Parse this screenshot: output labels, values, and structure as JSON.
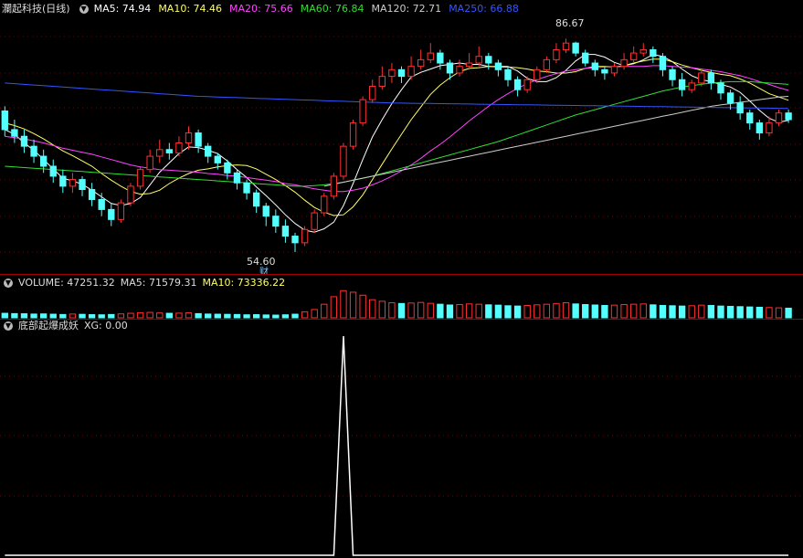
{
  "main": {
    "title": "瀾起科技(日线)",
    "ma": [
      {
        "label": "MA5: 74.94",
        "color": "#ffffff"
      },
      {
        "label": "MA10: 74.46",
        "color": "#ffff66"
      },
      {
        "label": "MA20: 75.66",
        "color": "#ff44ff"
      },
      {
        "label": "MA60: 76.84",
        "color": "#33dd33"
      },
      {
        "label": "MA120: 72.71",
        "color": "#cccccc"
      },
      {
        "label": "MA250: 66.88",
        "color": "#3355ff"
      }
    ],
    "high_label": "86.67",
    "low_label": "54.60",
    "fin_marker": "财"
  },
  "volume": {
    "labels": [
      {
        "label": "VOLUME: 47251.32",
        "color": "#dddddd"
      },
      {
        "label": "MA5: 71579.31",
        "color": "#dddddd"
      },
      {
        "label": "MA10: 73336.22",
        "color": "#ffff66"
      }
    ]
  },
  "indicator": {
    "name": "底部起爆成妖",
    "xg": "XG: 0.00"
  },
  "colors": {
    "up": "#ff3030",
    "down": "#54ffff",
    "bg": "#000000",
    "grid": "#7a0000"
  },
  "chart_data": {
    "type": "candlestick",
    "price_range": [
      52,
      90
    ],
    "candles": [
      [
        75.8,
        73.0,
        76.5,
        72.0
      ],
      [
        73.0,
        72.0,
        74.5,
        71.0
      ],
      [
        72.0,
        70.5,
        73.0,
        69.5
      ],
      [
        70.5,
        69.0,
        71.5,
        68.0
      ],
      [
        69.0,
        67.5,
        70.0,
        66.5
      ],
      [
        67.5,
        66.0,
        68.5,
        65.0
      ],
      [
        66.0,
        64.5,
        67.0,
        63.5
      ],
      [
        64.5,
        65.5,
        66.5,
        63.5
      ],
      [
        65.5,
        64.0,
        66.0,
        63.0
      ],
      [
        64.0,
        62.5,
        65.0,
        61.5
      ],
      [
        62.5,
        61.0,
        63.5,
        60.0
      ],
      [
        61.0,
        59.5,
        62.0,
        58.5
      ],
      [
        59.5,
        62.0,
        62.5,
        59.0
      ],
      [
        62.0,
        64.5,
        65.0,
        61.5
      ],
      [
        64.5,
        67.0,
        67.5,
        64.0
      ],
      [
        67.0,
        69.0,
        70.0,
        66.5
      ],
      [
        69.0,
        70.0,
        71.5,
        68.0
      ],
      [
        70.0,
        69.5,
        71.0,
        68.5
      ],
      [
        69.5,
        71.0,
        72.0,
        69.0
      ],
      [
        71.0,
        72.5,
        73.5,
        70.0
      ],
      [
        72.5,
        70.5,
        73.0,
        69.5
      ],
      [
        70.5,
        69.0,
        71.0,
        68.0
      ],
      [
        69.0,
        68.0,
        69.5,
        67.0
      ],
      [
        68.0,
        66.5,
        68.5,
        65.5
      ],
      [
        66.5,
        65.0,
        67.0,
        64.0
      ],
      [
        65.0,
        63.5,
        65.5,
        62.5
      ],
      [
        63.5,
        61.5,
        64.0,
        60.5
      ],
      [
        61.5,
        60.0,
        62.0,
        58.5
      ],
      [
        60.0,
        58.5,
        61.0,
        57.5
      ],
      [
        58.5,
        57.0,
        59.5,
        56.0
      ],
      [
        57.0,
        56.0,
        57.5,
        54.6
      ],
      [
        56.0,
        58.0,
        58.5,
        55.5
      ],
      [
        58.0,
        60.5,
        61.0,
        57.5
      ],
      [
        60.5,
        63.0,
        63.5,
        60.0
      ],
      [
        63.0,
        66.0,
        66.5,
        62.5
      ],
      [
        66.0,
        70.5,
        71.0,
        65.5
      ],
      [
        70.5,
        74.0,
        74.5,
        70.0
      ],
      [
        74.0,
        77.5,
        78.0,
        73.5
      ],
      [
        77.5,
        79.5,
        80.5,
        77.0
      ],
      [
        79.5,
        81.0,
        82.5,
        79.0
      ],
      [
        81.0,
        82.0,
        83.0,
        80.0
      ],
      [
        82.0,
        81.0,
        82.5,
        80.0
      ],
      [
        81.0,
        82.5,
        84.0,
        80.5
      ],
      [
        82.5,
        83.5,
        85.0,
        82.0
      ],
      [
        83.5,
        84.5,
        86.0,
        83.0
      ],
      [
        84.5,
        83.0,
        85.0,
        82.0
      ],
      [
        83.0,
        81.5,
        83.5,
        80.5
      ],
      [
        81.5,
        82.5,
        83.5,
        81.0
      ],
      [
        82.5,
        83.0,
        84.5,
        82.0
      ],
      [
        83.0,
        84.0,
        85.5,
        82.5
      ],
      [
        84.0,
        83.0,
        84.5,
        82.0
      ],
      [
        83.0,
        82.0,
        83.5,
        81.0
      ],
      [
        82.0,
        80.5,
        82.5,
        79.5
      ],
      [
        80.5,
        79.0,
        81.0,
        78.0
      ],
      [
        79.0,
        80.5,
        81.0,
        78.5
      ],
      [
        80.5,
        82.0,
        82.5,
        80.0
      ],
      [
        82.0,
        83.5,
        84.0,
        81.5
      ],
      [
        83.5,
        85.0,
        86.0,
        83.0
      ],
      [
        85.0,
        86.0,
        86.67,
        84.5
      ],
      [
        86.0,
        84.5,
        86.2,
        84.0
      ],
      [
        84.5,
        83.0,
        85.0,
        82.5
      ],
      [
        83.0,
        82.0,
        83.5,
        81.0
      ],
      [
        82.0,
        81.5,
        82.5,
        80.5
      ],
      [
        81.5,
        82.5,
        83.0,
        81.0
      ],
      [
        82.5,
        83.5,
        84.5,
        82.0
      ],
      [
        83.5,
        84.5,
        85.5,
        83.0
      ],
      [
        84.5,
        85.0,
        86.0,
        84.0
      ],
      [
        85.0,
        84.0,
        85.5,
        83.0
      ],
      [
        84.0,
        82.0,
        84.5,
        81.0
      ],
      [
        82.0,
        80.5,
        82.5,
        79.5
      ],
      [
        80.5,
        79.0,
        81.5,
        78.0
      ],
      [
        79.0,
        80.0,
        80.5,
        78.5
      ],
      [
        80.0,
        81.5,
        82.0,
        79.5
      ],
      [
        81.5,
        80.0,
        82.0,
        79.0
      ],
      [
        80.0,
        78.5,
        80.5,
        77.5
      ],
      [
        78.5,
        77.0,
        79.0,
        76.0
      ],
      [
        77.0,
        75.5,
        78.0,
        74.5
      ],
      [
        75.5,
        74.0,
        76.0,
        73.0
      ],
      [
        74.0,
        72.5,
        74.5,
        71.5
      ],
      [
        72.5,
        74.0,
        75.0,
        72.0
      ],
      [
        74.0,
        75.5,
        76.0,
        73.5
      ],
      [
        75.5,
        74.5,
        76.0,
        74.0
      ]
    ],
    "ma5": [
      73,
      72.3,
      71,
      69.9,
      68.5,
      67.1,
      65.7,
      65.3,
      64.8,
      63.9,
      62.9,
      61.9,
      61.6,
      61.9,
      62.8,
      64.7,
      66.6,
      68.0,
      69.4,
      70.4,
      70.3,
      69.9,
      69.4,
      68.3,
      67.0,
      65.8,
      64.4,
      63.1,
      61.7,
      60.2,
      58.9,
      57.9,
      57.6,
      58.1,
      59.1,
      61.6,
      64.9,
      68.5,
      71.9,
      74.5,
      76.9,
      79.0,
      80.9,
      81.6,
      82.1,
      82.6,
      82.8,
      83.0,
      82.8,
      82.8,
      82.5,
      82.5,
      82.5,
      81.8,
      80.7,
      80.2,
      80.2,
      80.8,
      81.9,
      83.3,
      84.3,
      84.3,
      83.9,
      83.1,
      82.6,
      82.9,
      83.5,
      84.3,
      84.0,
      83.2,
      82.1,
      81.1,
      80.5,
      80.2,
      79.8,
      79.4,
      78.6,
      77.3,
      75.9,
      74.7,
      74.1,
      74.4
    ],
    "ma10": [
      74,
      73.6,
      73.1,
      72.4,
      71.6,
      70.7,
      69.8,
      69.1,
      68.3,
      67.5,
      66.4,
      65.4,
      64.5,
      63.7,
      63.3,
      63.4,
      63.9,
      64.9,
      65.7,
      66.4,
      66.9,
      67.1,
      67.4,
      67.6,
      67.7,
      67.6,
      67.1,
      66.3,
      65.5,
      64.6,
      63.6,
      62.4,
      61.3,
      60.6,
      60.1,
      60.2,
      61.4,
      63.2,
      65.5,
      67.8,
      70.1,
      72.3,
      74.5,
      76.4,
      78.3,
      79.7,
      80.8,
      81.7,
      82.2,
      82.3,
      82.5,
      82.4,
      82.4,
      82.3,
      82.1,
      81.8,
      81.7,
      81.5,
      81.5,
      81.7,
      82.2,
      82.5,
      82.5,
      82.4,
      82.6,
      83.0,
      83.3,
      83.6,
      83.6,
      83.2,
      82.7,
      82.3,
      81.9,
      81.6,
      81.3,
      81.1,
      80.6,
      80.0,
      79.2,
      78.4,
      77.9,
      77.4
    ],
    "ma20": [
      72,
      71.8,
      71.6,
      71.3,
      71.0,
      70.6,
      70.2,
      69.9,
      69.6,
      69.3,
      68.9,
      68.5,
      68.1,
      67.7,
      67.4,
      67.2,
      67.0,
      66.9,
      66.8,
      66.7,
      66.6,
      66.4,
      66.3,
      66.1,
      66.0,
      65.8,
      65.6,
      65.4,
      65.2,
      64.9,
      64.7,
      64.4,
      64.1,
      63.9,
      63.7,
      63.7,
      63.9,
      64.2,
      64.7,
      65.3,
      66.0,
      66.8,
      67.7,
      68.7,
      69.8,
      70.8,
      71.9,
      73.1,
      74.3,
      75.4,
      76.5,
      77.5,
      78.4,
      79.2,
      79.9,
      80.5,
      81.0,
      81.4,
      81.8,
      82.0,
      82.2,
      82.3,
      82.4,
      82.4,
      82.5,
      82.5,
      82.5,
      82.6,
      82.6,
      82.5,
      82.4,
      82.3,
      82.1,
      81.9,
      81.7,
      81.4,
      81.1,
      80.7,
      80.2,
      79.8,
      79.3,
      78.9
    ],
    "ma60": [
      67.5,
      67.4,
      67.3,
      67.2,
      67.1,
      67.0,
      66.9,
      66.8,
      66.7,
      66.6,
      66.5,
      66.4,
      66.3,
      66.2,
      66.1,
      66.0,
      65.9,
      65.8,
      65.7,
      65.6,
      65.5,
      65.4,
      65.3,
      65.2,
      65.1,
      65.0,
      64.9,
      64.8,
      64.7,
      64.6,
      64.5,
      64.5,
      64.6,
      64.7,
      64.9,
      65.1,
      65.4,
      65.7,
      66.0,
      66.4,
      66.8,
      67.2,
      67.6,
      68.0,
      68.4,
      68.8,
      69.2,
      69.6,
      70.0,
      70.4,
      70.8,
      71.2,
      71.7,
      72.2,
      72.7,
      73.2,
      73.7,
      74.2,
      74.7,
      75.2,
      75.6,
      76.0,
      76.4,
      76.8,
      77.2,
      77.6,
      78.0,
      78.4,
      78.8,
      79.1,
      79.4,
      79.6,
      79.8,
      80.0,
      80.1,
      80.2,
      80.2,
      80.2,
      80.1,
      80.0,
      79.9,
      79.8
    ],
    "ma120": [
      null,
      null,
      null,
      null,
      null,
      null,
      null,
      null,
      null,
      null,
      null,
      null,
      null,
      null,
      null,
      null,
      null,
      null,
      null,
      null,
      null,
      null,
      null,
      null,
      null,
      null,
      null,
      null,
      null,
      null,
      null,
      null,
      null,
      64.5,
      64.8,
      65.1,
      65.4,
      65.7,
      66.0,
      66.3,
      66.6,
      66.9,
      67.2,
      67.5,
      67.8,
      68.1,
      68.4,
      68.7,
      69.0,
      69.3,
      69.6,
      69.9,
      70.2,
      70.5,
      70.8,
      71.1,
      71.4,
      71.7,
      72.0,
      72.3,
      72.6,
      72.9,
      73.2,
      73.5,
      73.8,
      74.1,
      74.4,
      74.7,
      75.0,
      75.3,
      75.6,
      75.9,
      76.2,
      76.5,
      76.7,
      76.9,
      77.1,
      77.3,
      77.5,
      77.7,
      77.9,
      78.0
    ],
    "ma250": [
      80.0,
      79.9,
      79.8,
      79.7,
      79.6,
      79.5,
      79.4,
      79.3,
      79.2,
      79.1,
      79.0,
      78.9,
      78.8,
      78.7,
      78.6,
      78.5,
      78.4,
      78.3,
      78.2,
      78.1,
      78.0,
      77.95,
      77.9,
      77.85,
      77.8,
      77.75,
      77.7,
      77.65,
      77.6,
      77.55,
      77.5,
      77.45,
      77.4,
      77.35,
      77.3,
      77.25,
      77.2,
      77.15,
      77.1,
      77.05,
      77.0,
      76.98,
      76.96,
      76.94,
      76.92,
      76.9,
      76.88,
      76.86,
      76.84,
      76.82,
      76.8,
      76.78,
      76.76,
      76.74,
      76.72,
      76.7,
      76.68,
      76.66,
      76.64,
      76.62,
      76.6,
      76.58,
      76.56,
      76.54,
      76.52,
      76.5,
      76.48,
      76.46,
      76.44,
      76.42,
      76.4,
      76.38,
      76.36,
      76.34,
      76.32,
      76.3,
      76.28,
      76.26,
      76.24,
      76.22,
      76.2,
      76.18
    ],
    "volume": [
      30,
      28,
      27,
      25,
      26,
      24,
      22,
      25,
      23,
      21,
      20,
      22,
      26,
      30,
      34,
      36,
      32,
      30,
      31,
      33,
      28,
      25,
      24,
      23,
      22,
      20,
      21,
      19,
      18,
      20,
      24,
      40,
      55,
      90,
      140,
      180,
      170,
      150,
      120,
      110,
      100,
      95,
      98,
      102,
      96,
      90,
      85,
      88,
      92,
      90,
      86,
      84,
      80,
      78,
      82,
      86,
      90,
      95,
      100,
      92,
      88,
      85,
      82,
      84,
      88,
      90,
      92,
      86,
      82,
      80,
      78,
      80,
      84,
      82,
      78,
      76,
      74,
      72,
      70,
      68,
      66,
      64
    ],
    "xg": [
      0,
      0,
      0,
      0,
      0,
      0,
      0,
      0,
      0,
      0,
      0,
      0,
      0,
      0,
      0,
      0,
      0,
      0,
      0,
      0,
      0,
      0,
      0,
      0,
      0,
      0,
      0,
      0,
      0,
      0,
      0,
      0,
      0,
      0,
      0,
      1,
      0,
      0,
      0,
      0,
      0,
      0,
      0,
      0,
      0,
      0,
      0,
      0,
      0,
      0,
      0,
      0,
      0,
      0,
      0,
      0,
      0,
      0,
      0,
      0,
      0,
      0,
      0,
      0,
      0,
      0,
      0,
      0,
      0,
      0,
      0,
      0,
      0,
      0,
      0,
      0,
      0,
      0,
      0,
      0,
      0,
      0
    ]
  }
}
